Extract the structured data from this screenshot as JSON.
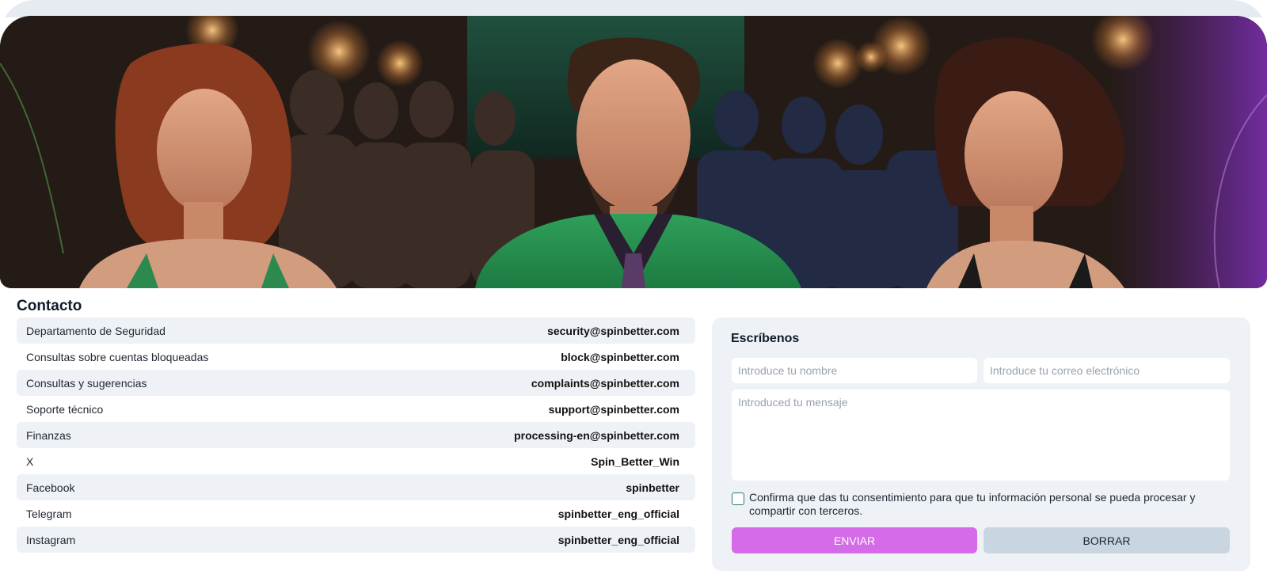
{
  "banner": {
    "image_alt": "",
    "accent_color": "#2fa05a"
  },
  "contact": {
    "title": "Contacto",
    "rows": [
      {
        "label": "Departamento de Seguridad",
        "value": "security@spinbetter.com"
      },
      {
        "label": "Consultas sobre cuentas bloqueadas",
        "value": "block@spinbetter.com"
      },
      {
        "label": "Consultas y sugerencias",
        "value": "complaints@spinbetter.com"
      },
      {
        "label": "Soporte técnico",
        "value": "support@spinbetter.com"
      },
      {
        "label": "Finanzas",
        "value": "processing-en@spinbetter.com"
      },
      {
        "label": "X",
        "value": "Spin_Better_Win"
      },
      {
        "label": "Facebook",
        "value": "spinbetter"
      },
      {
        "label": "Telegram",
        "value": "spinbetter_eng_official"
      },
      {
        "label": "Instagram",
        "value": "spinbetter_eng_official"
      }
    ]
  },
  "form": {
    "title": "Escríbenos",
    "name_placeholder": "Introduce tu nombre",
    "email_placeholder": "Introduce tu correo electrónico",
    "message_placeholder": "Introduced tu mensaje",
    "name_value": "",
    "email_value": "",
    "message_value": "",
    "consent_checked": false,
    "consent_text": "Confirma que das tu consentimiento para que tu información personal se pueda procesar y compartir con terceros.",
    "send_label": "ENVIAR",
    "clear_label": "BORRAR"
  },
  "colors": {
    "send_button": "#d56be8",
    "clear_button": "#c9d5e1",
    "row_alt": "#eef2f7",
    "checkbox_border": "#2c7a63"
  }
}
